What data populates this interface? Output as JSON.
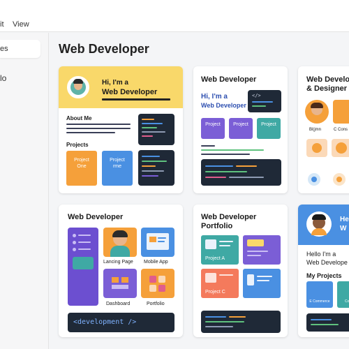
{
  "menubar": {
    "edit_label": "it",
    "view_label": "View"
  },
  "sidebar": {
    "item_top": "es",
    "item_second": "lo"
  },
  "page": {
    "title": "Web Developer"
  },
  "card1": {
    "greeting": "Hi, I'm a",
    "role": "Web Developer",
    "about_title": "About Me",
    "projects_title": "Projects",
    "project_one": "Project One",
    "project_two": "Project rme"
  },
  "card2": {
    "title": "Web Developer",
    "greeting": "Hi, I'm a",
    "role": "Web Developer",
    "code_glyph": "</>",
    "tiles": [
      "Project",
      "Project",
      "Project"
    ]
  },
  "card3": {
    "title_line1": "Web Develo",
    "title_line2": "& Designer",
    "label_a": "Bl(jmn",
    "label_b": "C Cons"
  },
  "card4": {
    "title": "Web Developer",
    "landing_label": "Lancing Page",
    "mobile_label": "Mobile App",
    "dashboard_label": "Dashboard",
    "portfolio_label": "Portfolio",
    "code_banner": "<development />"
  },
  "card5": {
    "title_line1": "Web Developer",
    "title_line2": "Portfolio",
    "project_a": "Project A",
    "project_c": "Project C"
  },
  "card6": {
    "hero_text_1": "He",
    "hero_text_2": "W",
    "greeting": "Hello I'm a",
    "role": "Web Develope",
    "projects_title": "My Projects",
    "tile_a": "E Commerce",
    "tile_b": "Cor"
  },
  "colors": {
    "accent_blue": "#4a90e2",
    "accent_orange": "#f5a03a",
    "accent_purple": "#7b5ed6",
    "accent_yellow": "#f9d86a",
    "dark": "#1f2937"
  }
}
